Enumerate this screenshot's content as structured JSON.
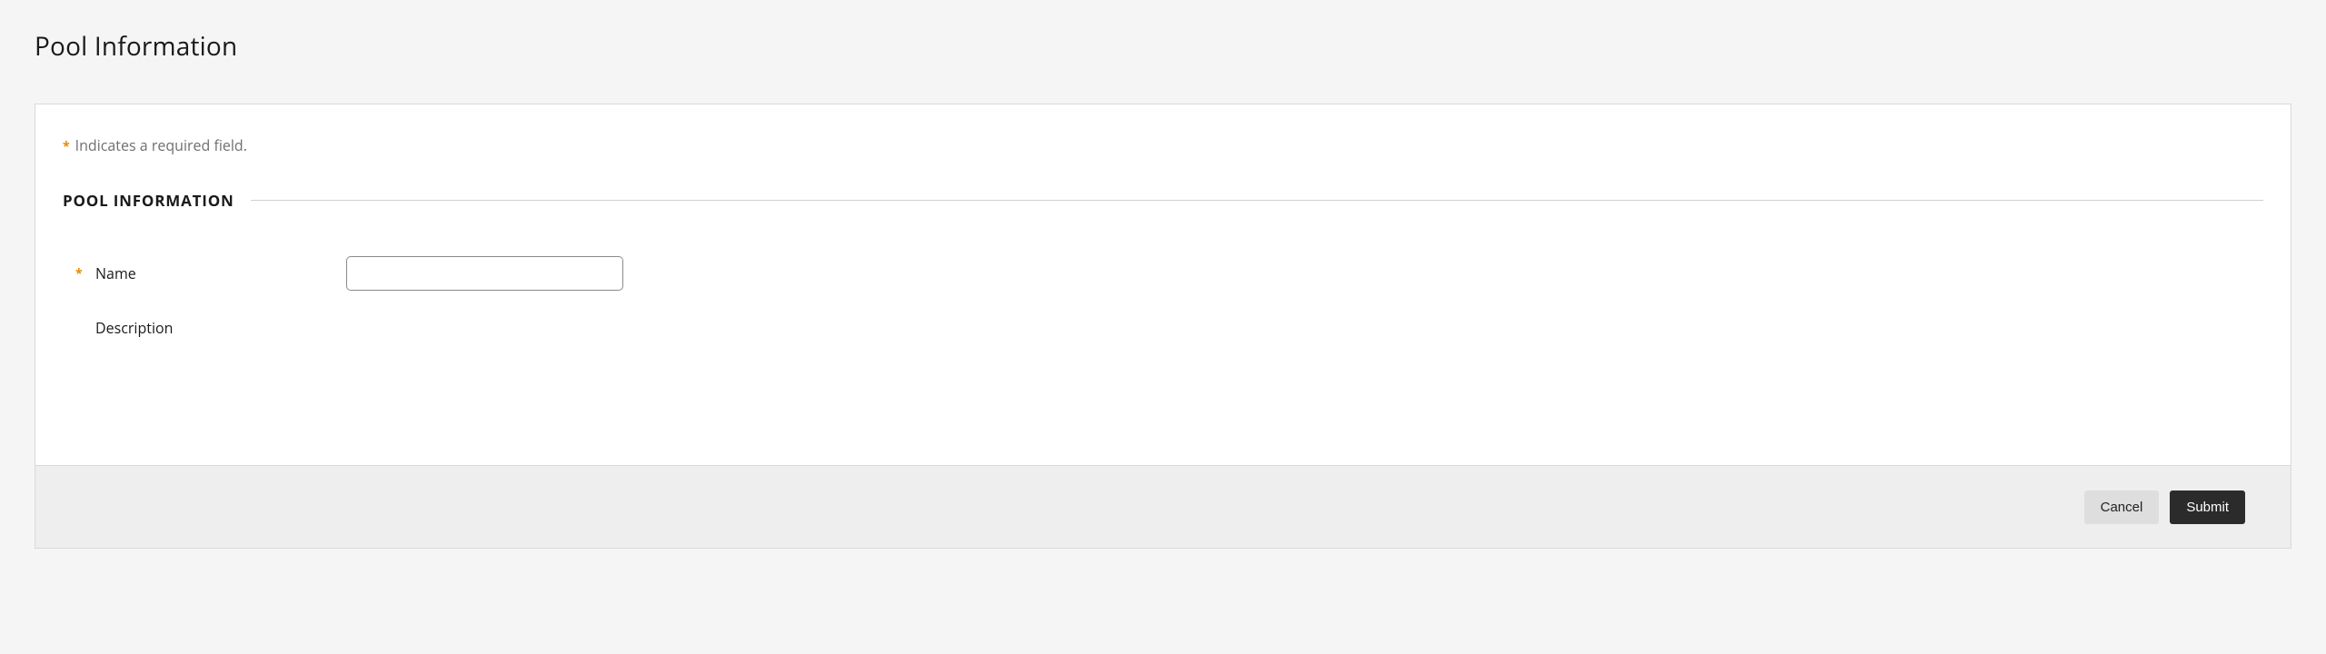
{
  "page": {
    "title": "Pool Information"
  },
  "notes": {
    "required_text": "Indicates a required field."
  },
  "section": {
    "title": "POOL INFORMATION"
  },
  "fields": {
    "name": {
      "label": "Name",
      "value": ""
    },
    "description": {
      "label": "Description"
    }
  },
  "buttons": {
    "cancel": "Cancel",
    "submit": "Submit"
  }
}
